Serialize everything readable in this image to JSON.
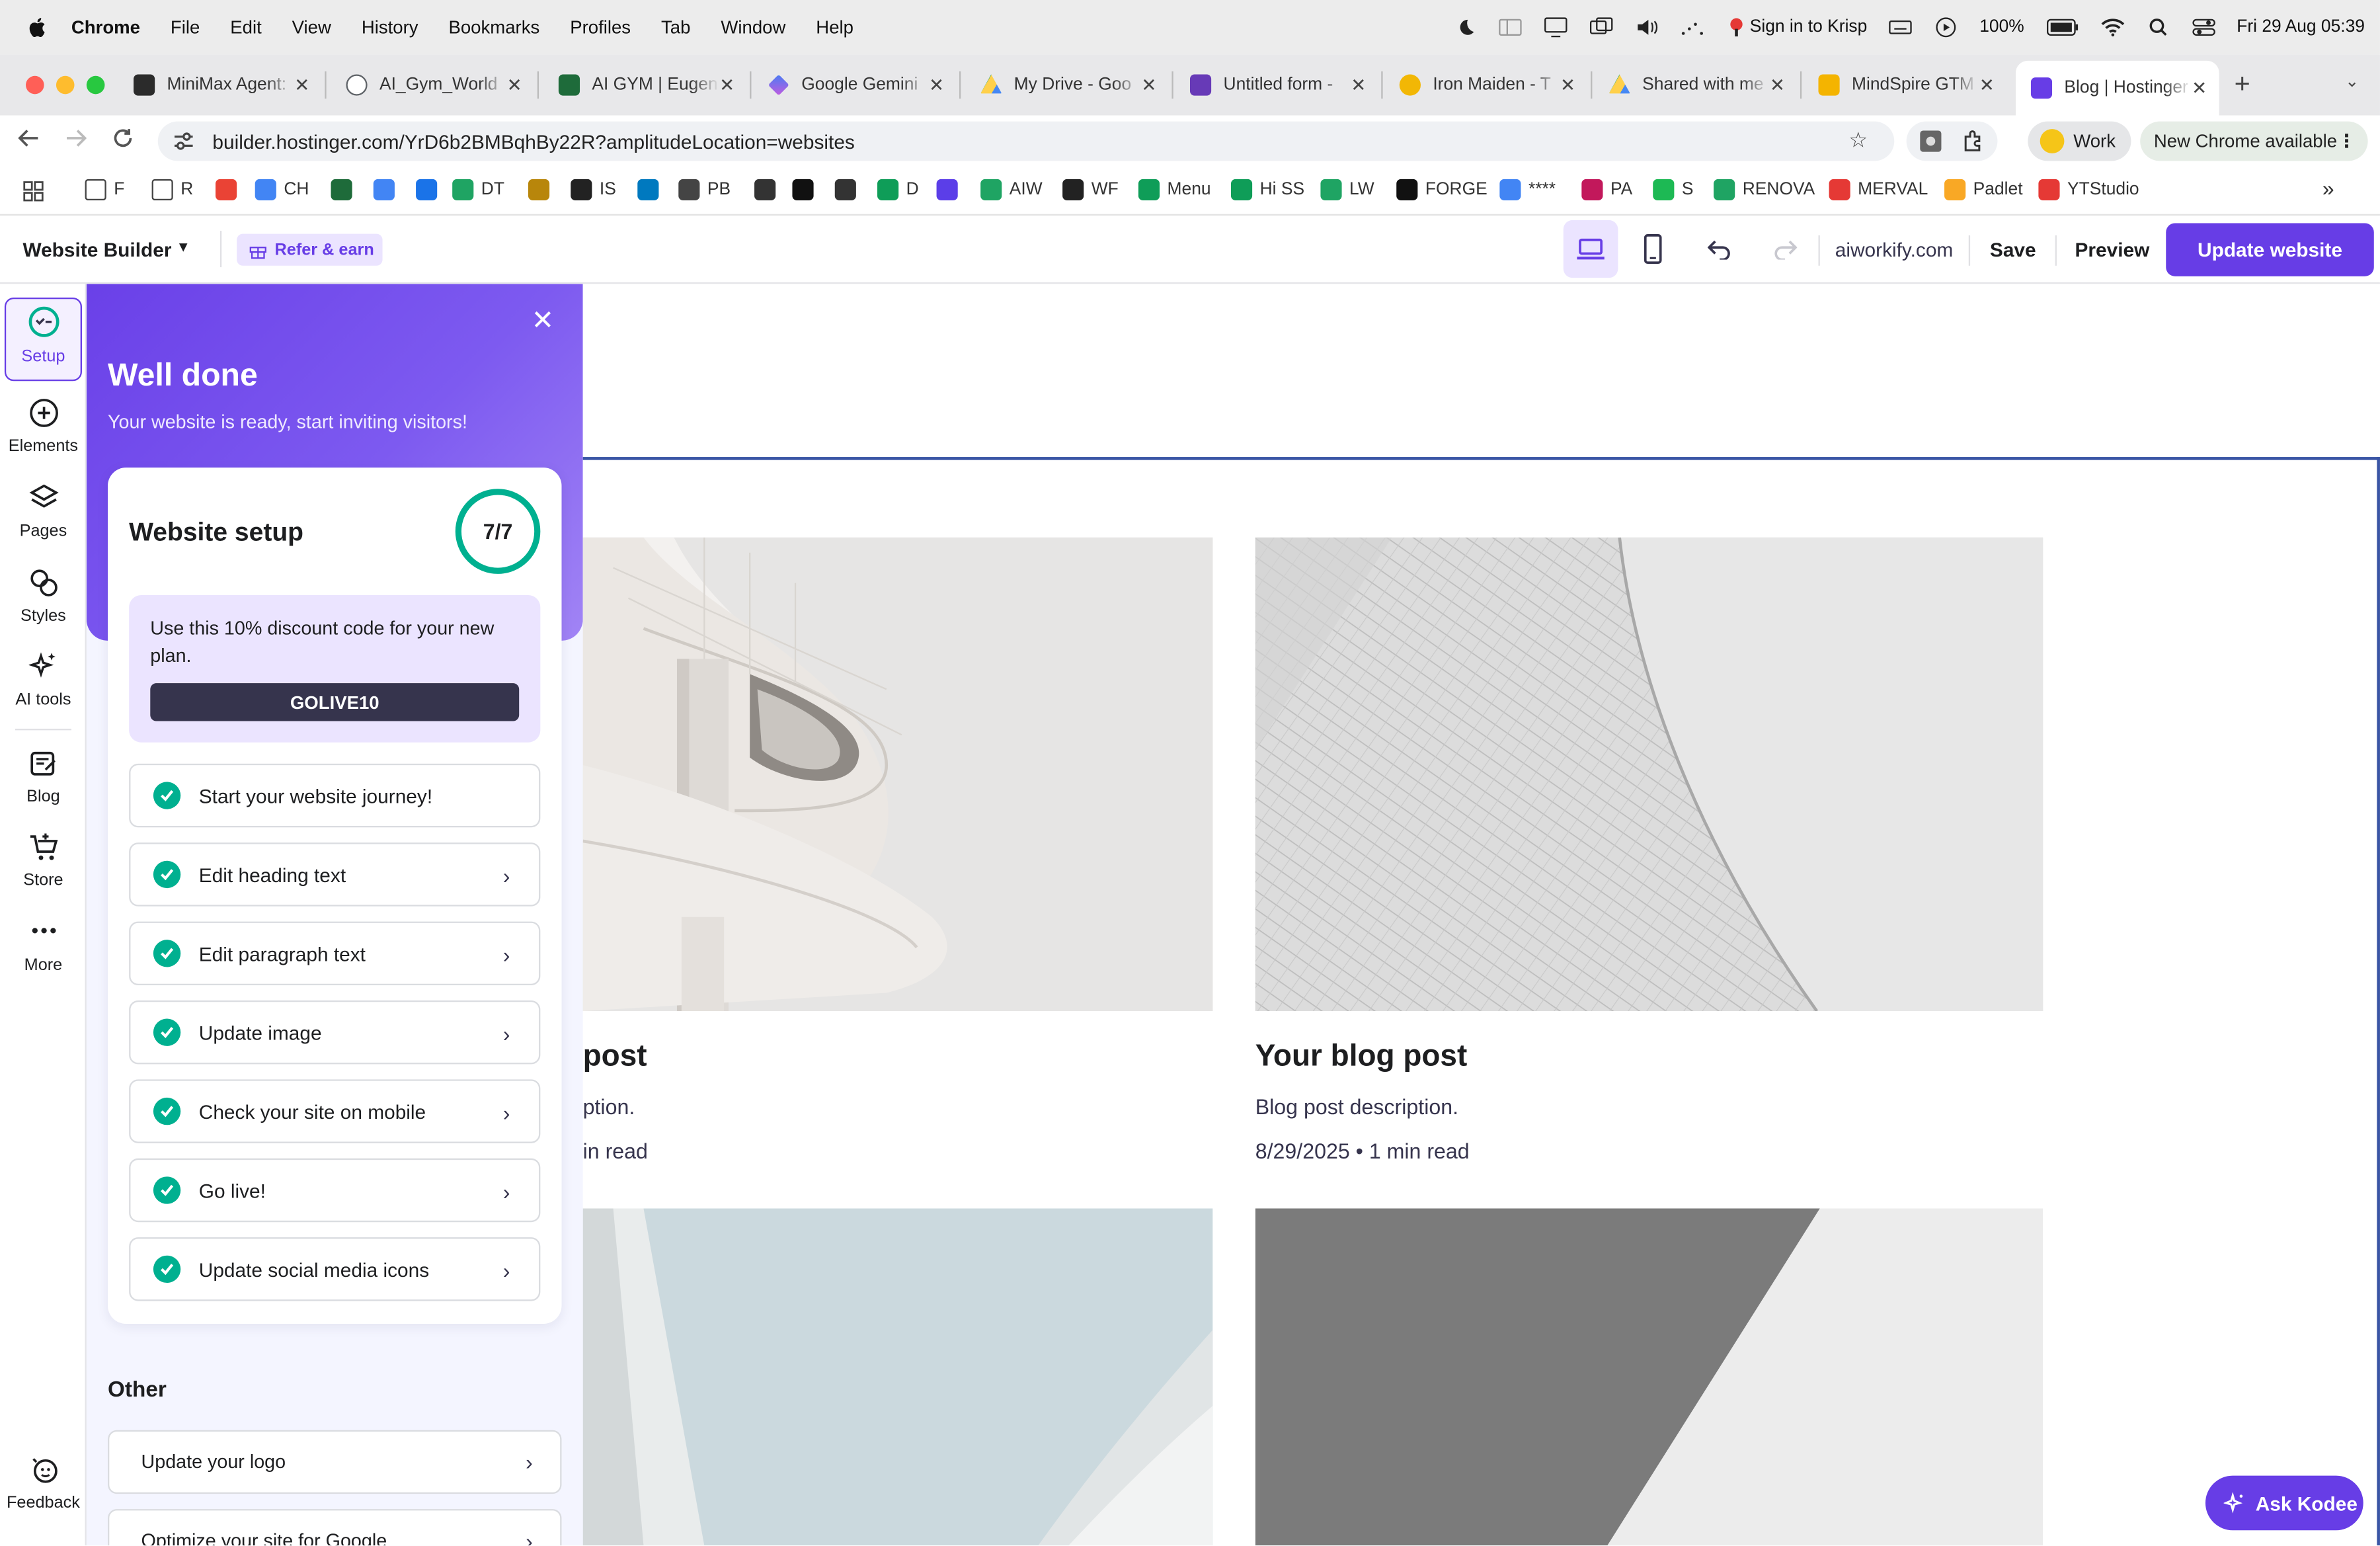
{
  "menubar": {
    "app": "Chrome",
    "items": [
      "File",
      "Edit",
      "View",
      "History",
      "Bookmarks",
      "Profiles",
      "Tab",
      "Window",
      "Help"
    ],
    "krisp": "Sign in to Krisp",
    "battery": "100%",
    "datetime": "Fri 29 Aug  05:39"
  },
  "tabs": [
    {
      "label": "MiniMax Agent:",
      "color": "#e84a5f"
    },
    {
      "label": "AI_Gym_World",
      "color": "#5f6368"
    },
    {
      "label": "AI GYM | Eugen",
      "color": "#1e6b3a"
    },
    {
      "label": "Google Gemini",
      "color": "#4a7cf3"
    },
    {
      "label": "My Drive - Goo",
      "color": "#1fa463"
    },
    {
      "label": "Untitled form -",
      "color": "#673ab7"
    },
    {
      "label": "Iron Maiden - T",
      "color": "#f2b705"
    },
    {
      "label": "Shared with me",
      "color": "#1fa463"
    },
    {
      "label": "MindSpire GTM",
      "color": "#f4b400"
    },
    {
      "label": "Blog | Hostinger",
      "color": "#673de6"
    }
  ],
  "address": {
    "url": "builder.hostinger.com/YrD6b2BMBqhBy22R?amplitudeLocation=websites",
    "profile": "Work",
    "update": "New Chrome available"
  },
  "bookmarks": [
    {
      "label": "F",
      "color": "#444"
    },
    {
      "label": "R",
      "color": "#444"
    },
    {
      "label": "",
      "color": "#ea4335"
    },
    {
      "label": "CH",
      "color": "#4285f4"
    },
    {
      "label": "",
      "color": "#1e6b3a"
    },
    {
      "label": "",
      "color": "#4285f4"
    },
    {
      "label": "",
      "color": "#1a73e8"
    },
    {
      "label": "DT",
      "color": "#1fa463"
    },
    {
      "label": "",
      "color": "#b8860b"
    },
    {
      "label": "IS",
      "color": "#222"
    },
    {
      "label": "",
      "color": "#0079bf"
    },
    {
      "label": "PB",
      "color": "#444"
    },
    {
      "label": "",
      "color": "#333"
    },
    {
      "label": "",
      "color": "#111"
    },
    {
      "label": "",
      "color": "#333"
    },
    {
      "label": "D",
      "color": "#0f9d58"
    },
    {
      "label": "",
      "color": "#5b3ee8"
    },
    {
      "label": "AIW",
      "color": "#1fa463"
    },
    {
      "label": "WF",
      "color": "#222"
    },
    {
      "label": "Menu",
      "color": "#0f9d58"
    },
    {
      "label": "Hi SS",
      "color": "#0f9d58"
    },
    {
      "label": "LW",
      "color": "#1fa463"
    },
    {
      "label": "FORGE",
      "color": "#111"
    },
    {
      "label": "****",
      "color": "#4285f4"
    },
    {
      "label": "PA",
      "color": "#c2185b"
    },
    {
      "label": "S",
      "color": "#1db954"
    },
    {
      "label": "RENOVA",
      "color": "#1fa463"
    },
    {
      "label": "MERVAL",
      "color": "#e53935"
    },
    {
      "label": "Padlet",
      "color": "#f9a825"
    },
    {
      "label": "YTStudio",
      "color": "#e53935"
    }
  ],
  "builder": {
    "product": "Website Builder",
    "refer": "Refer & earn",
    "domain": "aiworkify.com",
    "save": "Save",
    "preview": "Preview",
    "update": "Update website"
  },
  "rail": [
    {
      "label": "Setup"
    },
    {
      "label": "Elements"
    },
    {
      "label": "Pages"
    },
    {
      "label": "Styles"
    },
    {
      "label": "AI tools"
    },
    {
      "label": "Blog"
    },
    {
      "label": "Store"
    },
    {
      "label": "More"
    },
    {
      "label": "Feedback"
    }
  ],
  "panel": {
    "title": "Well done",
    "subtitle": "Your website is ready, start inviting visitors!",
    "card_title": "Website setup",
    "progress": "7/7",
    "promo_text": "Use this 10% discount code for your new plan.",
    "promo_code": "GOLIVE10",
    "tasks": [
      "Start your website journey!",
      "Edit heading text",
      "Edit paragraph text",
      "Update image",
      "Check your site on mobile",
      "Go live!",
      "Update social media icons"
    ],
    "other_heading": "Other",
    "other_tasks": [
      "Update your logo",
      "Optimize your site for Google"
    ]
  },
  "posts": [
    {
      "title": "post",
      "desc": "ption.",
      "meta": "in read"
    },
    {
      "title": "Your blog post",
      "desc": "Blog post description.",
      "meta": "8/29/2025 • 1 min read"
    }
  ],
  "ask": "Ask Kodee"
}
